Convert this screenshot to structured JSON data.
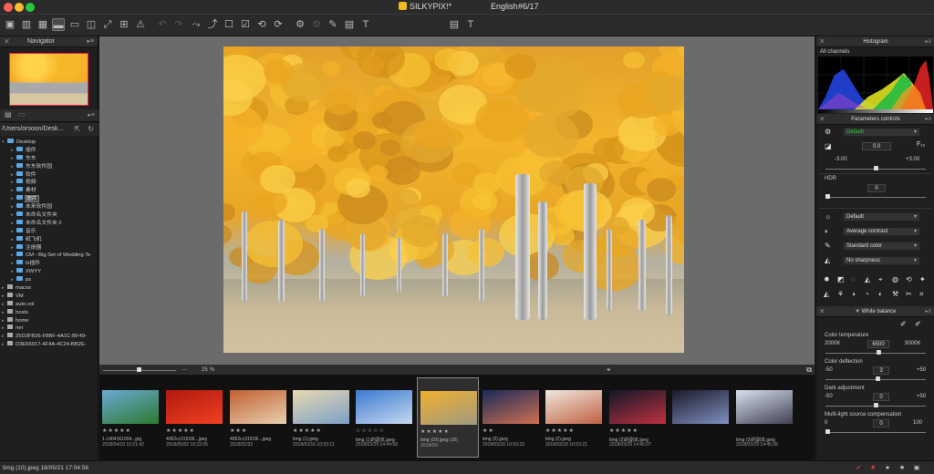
{
  "titlebar": {
    "app_title": "SILKYPIX",
    "title_suffix": "!*",
    "language": "English",
    "counter": "#6/17"
  },
  "navigator": {
    "title": "Navigator"
  },
  "browser": {
    "path": "/Users/orsoon/Desk..."
  },
  "tree": [
    {
      "label": "Desktop",
      "level": 0,
      "kind": "folder",
      "open": true
    },
    {
      "label": "插件",
      "level": 1,
      "kind": "folder"
    },
    {
      "label": "东东",
      "level": 1,
      "kind": "folder"
    },
    {
      "label": "东东软件园",
      "level": 1,
      "kind": "folder"
    },
    {
      "label": "软件",
      "level": 1,
      "kind": "folder"
    },
    {
      "label": "视频",
      "level": 1,
      "kind": "folder"
    },
    {
      "label": "素材",
      "level": 1,
      "kind": "folder"
    },
    {
      "label": "图片",
      "level": 1,
      "kind": "folder",
      "selected": true
    },
    {
      "label": "未来软件园",
      "level": 1,
      "kind": "folder"
    },
    {
      "label": "未命名文件夹",
      "level": 1,
      "kind": "folder"
    },
    {
      "label": "未命名文件夹 2",
      "level": 1,
      "kind": "folder"
    },
    {
      "label": "音乐",
      "level": 1,
      "kind": "folder"
    },
    {
      "label": "纸飞机",
      "level": 1,
      "kind": "folder"
    },
    {
      "label": "注册器",
      "level": 1,
      "kind": "folder"
    },
    {
      "label": "CM - Big Set of Wedding Te",
      "level": 1,
      "kind": "folder"
    },
    {
      "label": "fx插件",
      "level": 1,
      "kind": "folder"
    },
    {
      "label": "XWYY",
      "level": 1,
      "kind": "folder"
    },
    {
      "label": "ps",
      "level": 1,
      "kind": "folder"
    },
    {
      "label": "macos",
      "level": 0,
      "kind": "disk"
    },
    {
      "label": "VM",
      "level": 0,
      "kind": "disk"
    },
    {
      "label": "auto.vol",
      "level": 0,
      "kind": "disk"
    },
    {
      "label": "hosts",
      "level": 0,
      "kind": "disk"
    },
    {
      "label": "home",
      "level": 0,
      "kind": "disk"
    },
    {
      "label": "net",
      "level": 0,
      "kind": "disk"
    },
    {
      "label": "25D3FB36-F8BF-4A1C-BF49-",
      "level": 0,
      "kind": "disk"
    },
    {
      "label": "D3E66017-4F4A-4C24-BB2E-",
      "level": 0,
      "kind": "disk"
    }
  ],
  "zoom": {
    "value": "25",
    "unit": "%"
  },
  "filmstrip": [
    {
      "name": "1-1404161004...jpg",
      "date": "2018/04/10 10:21:42",
      "stars": "★★★★★",
      "colors": [
        "#6ea8d6",
        "#2b7a2e"
      ]
    },
    {
      "name": "4062cc3191f6...jpeg",
      "date": "2018/05/02 10:22:05",
      "stars": "★★★★★",
      "colors": [
        "#b01a10",
        "#f04020"
      ]
    },
    {
      "name": "4062cc3191f6...jpeg",
      "date": "2018/02/33",
      "stars": "★★★",
      "colors": [
        "#c06030",
        "#e8d0b0"
      ]
    },
    {
      "name": "timg (1).jpeg",
      "date": "2018/03/16 10:53:11",
      "stars": "★★★★★",
      "colors": [
        "#e9d8b0",
        "#7aa0c8"
      ]
    },
    {
      "name": "timg (1)的副本.jpeg",
      "date": "2018/03/29 14:44:58",
      "stars": "☆☆☆☆☆",
      "colors": [
        "#3a7ad0",
        "#c8d8f0"
      ]
    },
    {
      "name": "timg (10).jpeg (10)",
      "date": "2018/05/",
      "stars": "★★★★★",
      "colors": [
        "#f0b030",
        "#a09a80"
      ]
    },
    {
      "name": "timg (2).jpeg",
      "date": "2018/03/16 10:53:23",
      "stars": "★★",
      "colors": [
        "#1a2a5a",
        "#d07050"
      ]
    },
    {
      "name": "timg (2).jpeg",
      "date": "2018/03/16 10:53:21",
      "stars": "★★★★★",
      "colors": [
        "#f0e8e0",
        "#c06040"
      ]
    },
    {
      "name": "timg (2)的副本.jpeg",
      "date": "2018/03/29 14:45:07",
      "stars": "★★★★★",
      "colors": [
        "#101828",
        "#c03040"
      ]
    },
    {
      "name": "",
      "date": "",
      "stars": "",
      "colors": [
        "#1a1a2a",
        "#8090c0"
      ]
    },
    {
      "name": "timg (3)的副本.jpeg",
      "date": "2018/03/29 14:45:08",
      "stars": "",
      "colors": [
        "#d8e0f0",
        "#404050"
      ]
    }
  ],
  "status": {
    "text": "timg (10).jpeg 18/05/21 17:04:56"
  },
  "histogram": {
    "title": "Histogram",
    "channel": "All channels"
  },
  "params": {
    "title": "Parameters controls",
    "preset": "Default",
    "exposure_value": "0.0",
    "exposure_min": "-3.00",
    "exposure_max": "+3.00",
    "hdr_label": "HDR",
    "hdr_value": "0",
    "tone_default": "Default",
    "contrast": "Average contrast",
    "color": "Standard color",
    "sharpness": "No sharpness"
  },
  "white_balance": {
    "title": "White balance",
    "color_temp_label": "Color temperature",
    "color_temp_min": "2000K",
    "color_temp_value": "6500",
    "color_temp_max": "9000K",
    "color_deflection_label": "Color deflection",
    "cd_min": "-50",
    "cd_value": "3",
    "cd_max": "+50",
    "dark_adj_label": "Dark adjustment",
    "da_min": "-50",
    "da_value": "0",
    "da_max": "+50",
    "multi_light_label": "Multi-light source compensation",
    "ml_min": "0",
    "ml_value": "0",
    "ml_max": "100"
  }
}
